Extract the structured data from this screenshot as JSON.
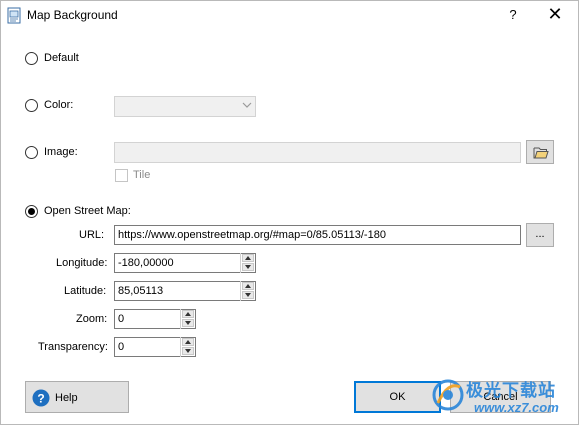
{
  "window": {
    "title": "Map Background",
    "help_label": "?",
    "close_label": "✕"
  },
  "options": {
    "default_label": "Default",
    "color_label": "Color:",
    "image_label": "Image:",
    "tile_label": "Tile",
    "osm_label": "Open Street Map:",
    "selected": "osm"
  },
  "fields": {
    "url_label": "URL:",
    "url_value": "https://www.openstreetmap.org/#map=0/85.05113/-180",
    "browse_label": "...",
    "longitude_label": "Longitude:",
    "longitude_value": "-180,00000",
    "latitude_label": "Latitude:",
    "latitude_value": "85,05113",
    "zoom_label": "Zoom:",
    "zoom_value": "0",
    "transparency_label": "Transparency:",
    "transparency_value": "0"
  },
  "buttons": {
    "help": "Help",
    "ok": "OK",
    "cancel": "Cancel"
  },
  "watermark": {
    "text_cn": "极光下载站",
    "url": "www.xz7.com"
  },
  "colors": {
    "accent": "#0078d7",
    "help_icon": "#1e6fc0"
  }
}
